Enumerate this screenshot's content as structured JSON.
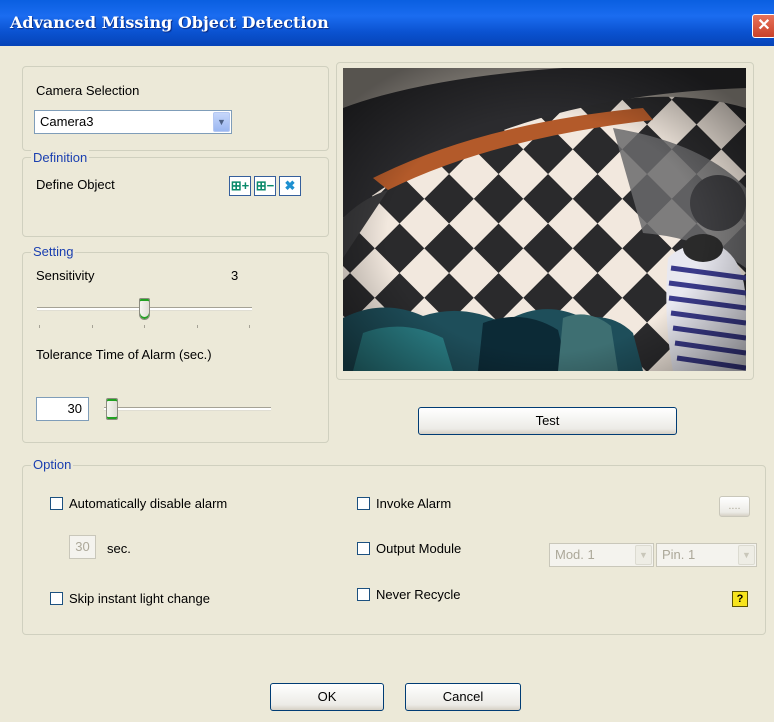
{
  "window": {
    "title": "Advanced Missing Object Detection",
    "close_glyph": "✕"
  },
  "camera": {
    "label": "Camera Selection",
    "selected": "Camera3"
  },
  "definition": {
    "group_label": "Definition",
    "define_label": "Define Object",
    "tools": [
      {
        "icon": "add-region-icon",
        "glyph": "⊞+"
      },
      {
        "icon": "remove-region-icon",
        "glyph": "⊞−"
      },
      {
        "icon": "delete-icon",
        "glyph": "✖"
      }
    ]
  },
  "setting": {
    "group_label": "Setting",
    "sensitivity_label": "Sensitivity",
    "sensitivity_value": "3",
    "sensitivity_level": 3,
    "sensitivity_max": 5,
    "tolerance_label": "Tolerance Time of Alarm (sec.)",
    "tolerance_value": "30",
    "tolerance_level": 0.0
  },
  "preview": {
    "test_label": "Test"
  },
  "option": {
    "group_label": "Option",
    "auto_disable_label": "Automatically disable alarm",
    "auto_disable_seconds": "30",
    "sec_label": "sec.",
    "skip_light_label": "Skip instant light change",
    "invoke_alarm_label": "Invoke Alarm",
    "browse_label": "....",
    "output_module_label": "Output Module",
    "module_selected": "Mod. 1",
    "pin_selected": "Pin. 1",
    "never_recycle_label": "Never Recycle",
    "help_glyph": "?"
  },
  "footer": {
    "ok_label": "OK",
    "cancel_label": "Cancel"
  },
  "colors": {
    "group_label": "#1a3fb0",
    "title_bar": "#0a5fe0",
    "dialog_bg": "#ece9d8"
  }
}
